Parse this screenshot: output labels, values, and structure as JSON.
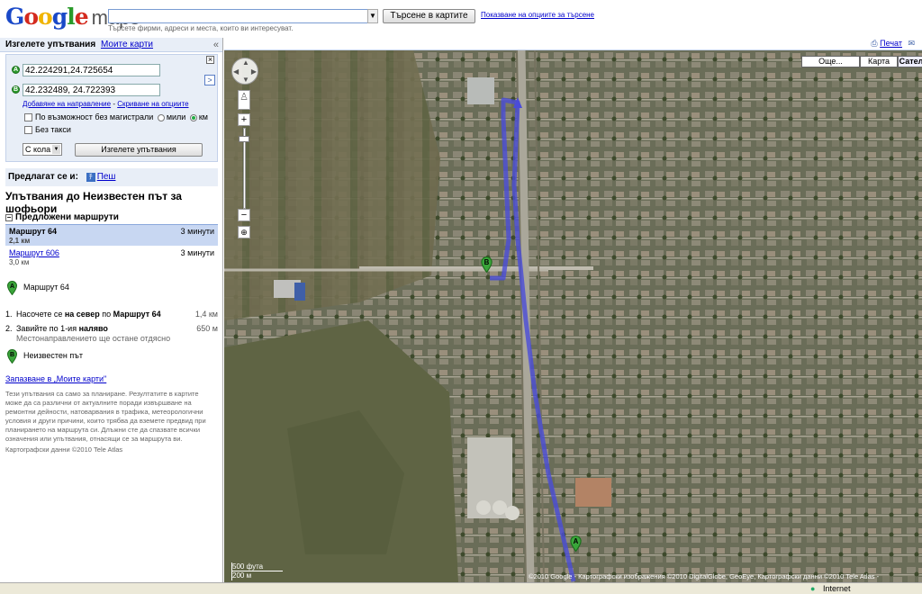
{
  "header": {
    "logo_google": "Google",
    "logo_maps": "maps",
    "search_value": "",
    "search_hint": "Търсете фирми, адреси и места, които ви интересуват.",
    "search_button": "Търсене в картите",
    "search_options": "Показване на опциите за търсене"
  },
  "sidebar": {
    "tab_directions": "Изгелете упътвания",
    "tab_mymaps": "Моите карти",
    "collapse": "«",
    "close": "×",
    "waypoint_a": "42.224291,24.725654",
    "waypoint_b": "42.232489, 24.722393",
    "add_destination": "Добавяне на направление",
    "hide_options": "Скриване на опциите",
    "avoid_highways": "По възможност без магистрали",
    "units_miles": "мили",
    "units_km": "км",
    "avoid_tolls": "Без такси",
    "mode_select": "С кола",
    "get_directions_button": "Изгелете упътвания",
    "suggested_label": "Предлагат се и:",
    "walk_label": "Пеш",
    "routes_title": "Упътвания до Неизвестен път за шофьори",
    "suggested_routes_header": "Предложени маршрути",
    "routes": [
      {
        "name": "Маршрут 64",
        "time": "3 минути",
        "distance": "2,1 км"
      },
      {
        "name": "Маршрут 606",
        "time": "3 минути",
        "distance": "3,0 км"
      }
    ],
    "start_label": "Маршрут 64",
    "steps": [
      {
        "num": "1.",
        "text_pre": "Насочете се ",
        "text_b1": "на север",
        "text_mid": " по ",
        "text_b2": "Маршрут 64",
        "distance": "1,4 км"
      },
      {
        "num": "2.",
        "text_pre": "Завийте по 1-ия ",
        "text_b1": "наляво",
        "sub": "Местонаправлението ще остане отдясно",
        "distance": "650 м"
      }
    ],
    "end_label": "Неизвестен път",
    "save_link": "Запазване в „Моите карти\"",
    "disclaimer": "Тези упътвания са само за планиране. Резултатите в картите може да са различни от актуалните поради извършване на ремонтни дейности, натоварвания в трафика, метеорологични условия и други причини, които трябва да вземете предвид при планирането на маршрута си. Длъжни сте да спазвате всички означения или упътвания, отнасящи се за маршрута ви.",
    "map_data": "Картографски данни ©2010 Tele Atlas"
  },
  "map": {
    "print_link": "Печат",
    "more_button": "Още...",
    "map_button": "Карта",
    "satellite_button": "Сател",
    "scale_ft": "500 фута",
    "scale_m": "200 м",
    "copyright": "©2010 Google - Картографски изображения ©2010 DigitalGlobe, GeoEye, Картографски данни ©2010 Tele Atlas -",
    "marker_a": "A",
    "marker_b": "B"
  },
  "statusbar": {
    "zone": "Internet"
  }
}
